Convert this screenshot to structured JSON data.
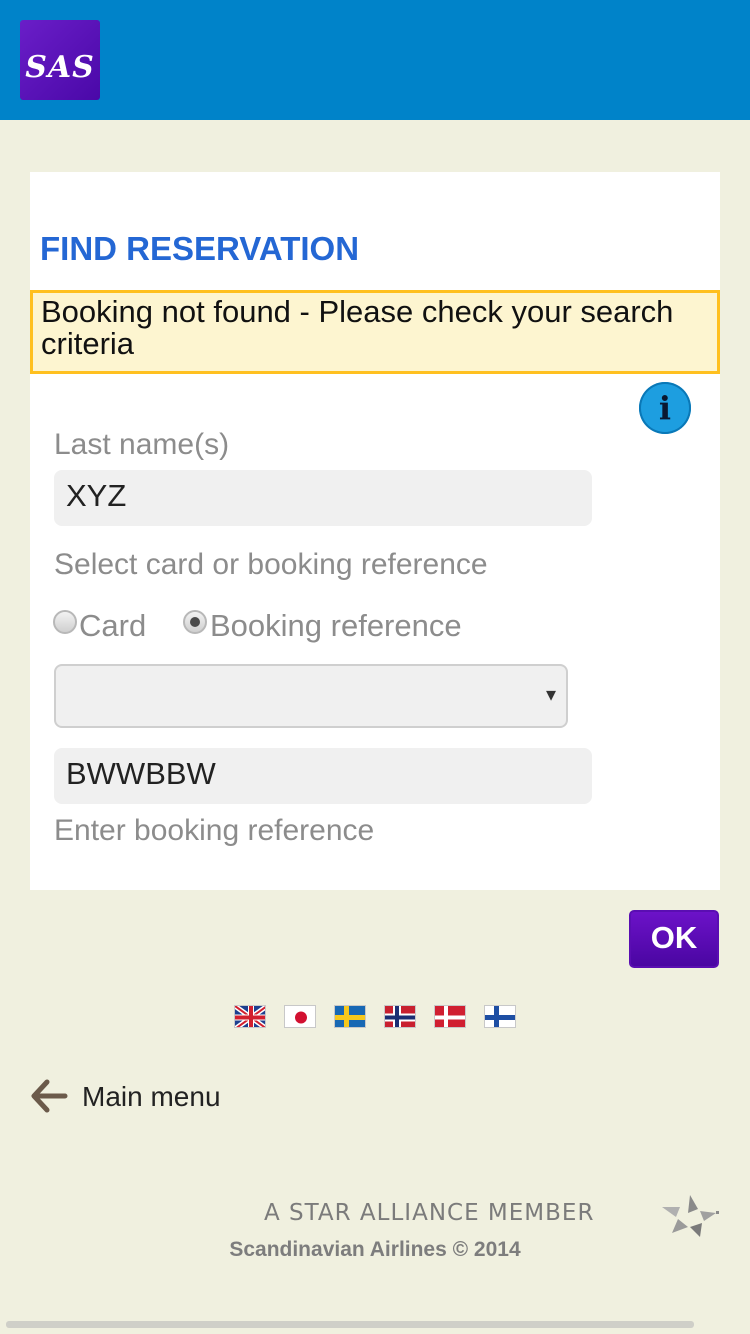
{
  "header": {
    "logo_text": "SAS",
    "background": "#0083c9"
  },
  "form": {
    "title": "FIND RESERVATION",
    "alert": "Booking not found - Please check your search criteria",
    "info_icon": "i",
    "last_name_label": "Last name(s)",
    "last_name_value": "XYZ",
    "select_label": "Select card or booking reference",
    "radio_card": "Card",
    "radio_booking": "Booking reference",
    "selected_option": "Booking reference",
    "dropdown_arrow": "▾",
    "dropdown_value": "",
    "booking_value": "BWWBBW",
    "booking_hint": "Enter booking reference",
    "ok_label": "OK"
  },
  "languages": [
    "uk-flag-icon",
    "japan-flag-icon",
    "sweden-flag-icon",
    "norway-flag-icon",
    "denmark-flag-icon",
    "finland-flag-icon"
  ],
  "nav": {
    "main_menu": "Main menu"
  },
  "footer": {
    "alliance": "A STAR ALLIANCE MEMBER",
    "copyright": "Scandinavian Airlines © 2014"
  },
  "colors": {
    "title": "#2467d4",
    "alert_border": "#ffc01f",
    "alert_background": "#fdf5d0",
    "ok_button": "#5a0eb2",
    "page_background": "#f0f0df"
  }
}
